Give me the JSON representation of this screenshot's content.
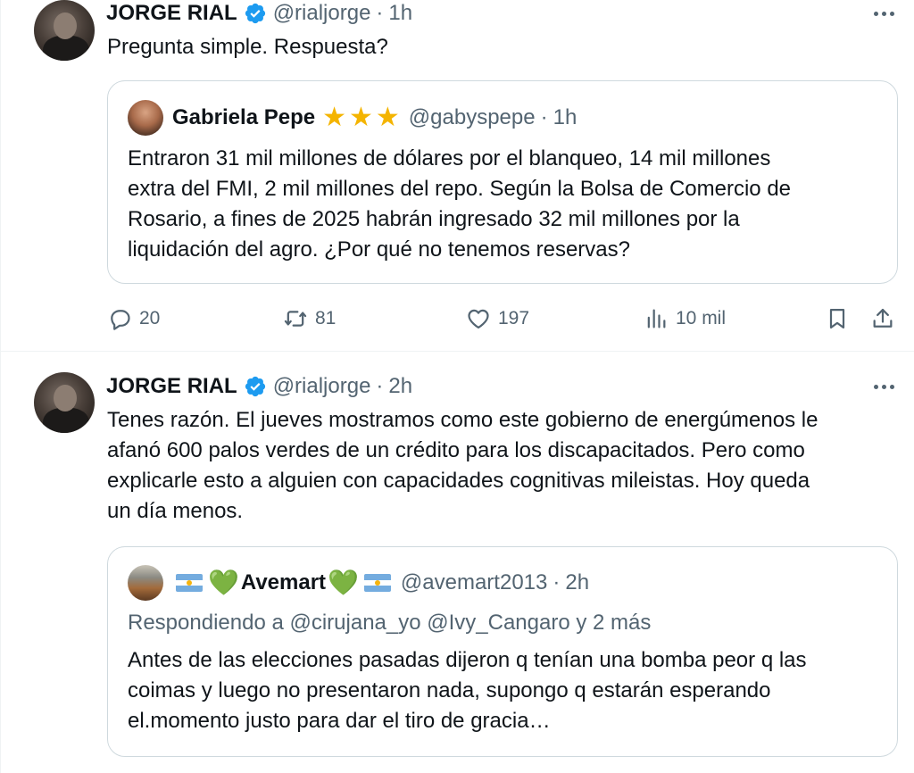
{
  "tweet1": {
    "author_name": "JORGE RIAL",
    "handle": "@rialjorge",
    "separator": "·",
    "time": "1h",
    "text": "Pregunta simple. Respuesta?",
    "quote": {
      "author_name": "Gabriela Pepe",
      "handle": "@gabyspepe",
      "separator": "·",
      "time": "1h",
      "star_icons": [
        "★",
        "★",
        "★"
      ],
      "lines": [
        "Entraron 31 mil millones de dólares por el blanqueo, 14 mil millones",
        "extra del FMI, 2 mil millones del repo. Según la Bolsa de Comercio de",
        "Rosario, a fines de 2025 habrán ingresado 32 mil millones por la",
        "liquidación del agro. ¿Por qué no tenemos reservas?"
      ]
    },
    "actions": {
      "replies": "20",
      "reposts": "81",
      "likes": "197",
      "views": "10 mil"
    }
  },
  "tweet2": {
    "author_name": "JORGE RIAL",
    "handle": "@rialjorge",
    "separator": "·",
    "time": "2h",
    "lines": [
      "Tenes razón. El jueves mostramos como este gobierno de energúmenos le",
      "afanó 600 palos verdes de un crédito para los discapacitados. Pero como",
      "explicarle esto a alguien con capacidades cognitivas mileistas. Hoy queda",
      "un día menos."
    ],
    "quote": {
      "author_name": "Avemart",
      "heart_icon": "💚",
      "handle": "@avemart2013",
      "separator": "·",
      "time": "2h",
      "replying_to": "Respondiendo a @cirujana_yo @Ivy_Cangaro y 2 más",
      "lines": [
        "Antes de las elecciones pasadas dijeron q tenían una bomba peor q las",
        "coimas y luego no presentaron nada, supongo q estarán esperando",
        "el.momento justo para dar el tiro de gracia…"
      ]
    }
  },
  "colors": {
    "text": "#0f1419",
    "secondary": "#536471",
    "verified": "#1d9bf0",
    "border": "#cfd9de",
    "star": "#f4b400",
    "heart": "#6abf4b",
    "flag_blue": "#74acdf"
  },
  "icons": {
    "reply": "reply-icon",
    "repost": "repost-icon",
    "like": "heart-icon",
    "views": "views-icon",
    "bookmark": "bookmark-icon",
    "share": "share-icon",
    "more": "more-icon",
    "verified": "verified-badge-icon",
    "flag": "argentina-flag-icon"
  }
}
